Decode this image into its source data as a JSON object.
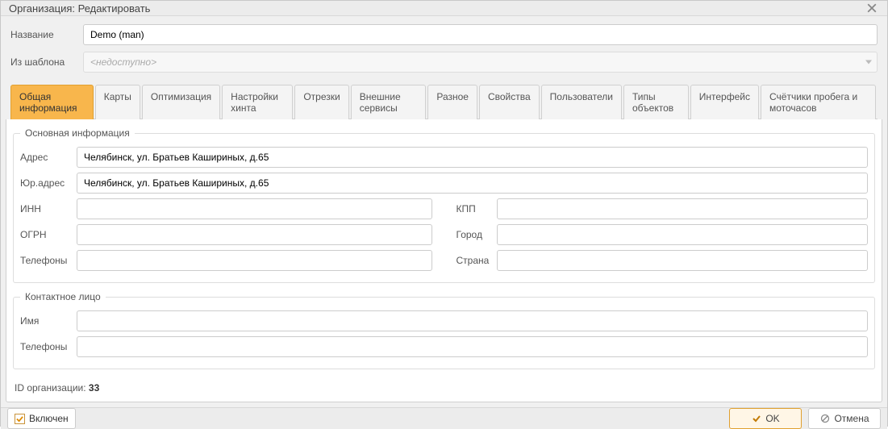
{
  "window": {
    "title": "Организация: Редактировать"
  },
  "header": {
    "name_label": "Название",
    "name_value": "Demo (man)",
    "template_label": "Из шаблона",
    "template_placeholder": "<недоступно>"
  },
  "tabs": [
    {
      "label": "Общая информация",
      "active": true
    },
    {
      "label": "Карты"
    },
    {
      "label": "Оптимизация"
    },
    {
      "label": "Настройки хинта"
    },
    {
      "label": "Отрезки"
    },
    {
      "label": "Внешние сервисы"
    },
    {
      "label": "Разное"
    },
    {
      "label": "Свойства"
    },
    {
      "label": "Пользователи"
    },
    {
      "label": "Типы объектов"
    },
    {
      "label": "Интерфейс"
    },
    {
      "label": "Счётчики пробега и моточасов"
    }
  ],
  "main": {
    "group_basic": {
      "legend": "Основная информация",
      "address_label": "Адрес",
      "address_value": "Челябинск, ул. Братьев Кашириных, д.65",
      "legal_address_label": "Юр.адрес",
      "legal_address_value": "Челябинск, ул. Братьев Кашириных, д.65",
      "inn_label": "ИНН",
      "inn_value": "",
      "kpp_label": "КПП",
      "kpp_value": "",
      "ogrn_label": "ОГРН",
      "ogrn_value": "",
      "city_label": "Город",
      "city_value": "",
      "phones_label": "Телефоны",
      "phones_value": "",
      "country_label": "Страна",
      "country_value": ""
    },
    "group_contact": {
      "legend": "Контактное лицо",
      "name_label": "Имя",
      "name_value": "",
      "phones_label": "Телефоны",
      "phones_value": ""
    },
    "org_id_label": "ID организации: ",
    "org_id_value": "33"
  },
  "footer": {
    "enabled_label": "Включен",
    "enabled_checked": true,
    "ok_label": "OK",
    "cancel_label": "Отмена"
  }
}
